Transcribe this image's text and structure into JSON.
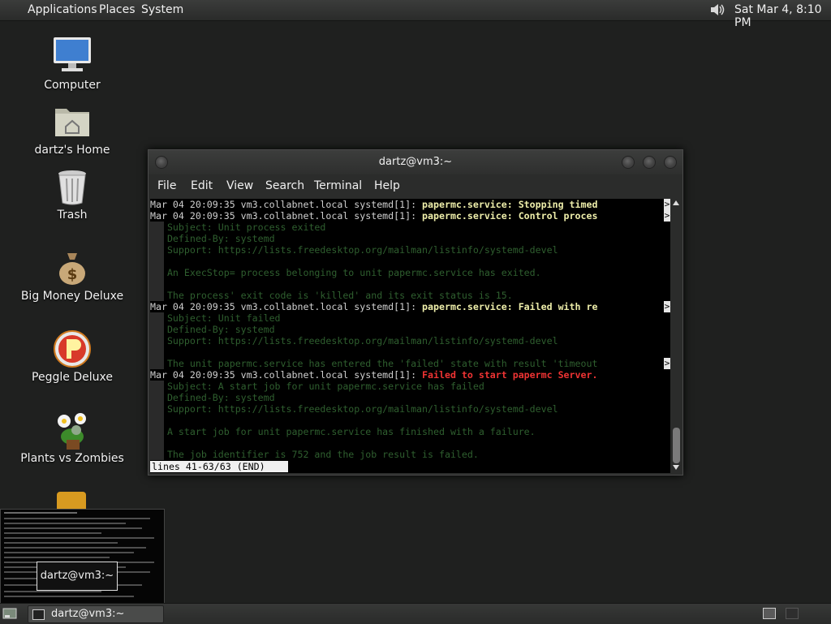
{
  "top_panel": {
    "menus": [
      "Applications",
      "Places",
      "System"
    ],
    "clock": "Sat Mar  4,  8:10 PM",
    "volume_icon": "speaker-icon"
  },
  "desktop_icons": [
    {
      "label": "Computer",
      "icon": "computer-icon"
    },
    {
      "label": "dartz's Home",
      "icon": "home-folder-icon"
    },
    {
      "label": "Trash",
      "icon": "trash-icon"
    },
    {
      "label": "Big Money Deluxe",
      "icon": "money-bag-icon"
    },
    {
      "label": "Peggle Deluxe",
      "icon": "peggle-icon"
    },
    {
      "label": "Plants vs Zombies",
      "icon": "plants-vs-zombies-icon"
    }
  ],
  "terminal": {
    "title": "dartz@vm3:~",
    "menu": [
      "File",
      "Edit",
      "View",
      "Search",
      "Terminal",
      "Help"
    ],
    "lines": [
      {
        "prefix": "Mar 04 20:09:35 vm3.collabnet.local systemd[1]: ",
        "msg": "papermc.service: Stopping timed",
        "style": "tw",
        "trunc": true
      },
      {
        "prefix": "Mar 04 20:09:35 vm3.collabnet.local systemd[1]: ",
        "msg": "papermc.service: Control proces",
        "style": "tw",
        "trunc": true
      },
      {
        "prefix": "",
        "msg": "   Subject: Unit process exited",
        "style": "tg",
        "trunc": false
      },
      {
        "prefix": "",
        "msg": "   Defined-By: systemd",
        "style": "tg",
        "trunc": false
      },
      {
        "prefix": "",
        "msg": "   Support: https://lists.freedesktop.org/mailman/listinfo/systemd-devel",
        "style": "tg",
        "trunc": false
      },
      {
        "prefix": "",
        "msg": "",
        "style": "tg",
        "trunc": false
      },
      {
        "prefix": "",
        "msg": "   An ExecStop= process belonging to unit papermc.service has exited.",
        "style": "tg",
        "trunc": false
      },
      {
        "prefix": "",
        "msg": "",
        "style": "tg",
        "trunc": false
      },
      {
        "prefix": "",
        "msg": "   The process' exit code is 'killed' and its exit status is 15.",
        "style": "tg",
        "trunc": false
      },
      {
        "prefix": "Mar 04 20:09:35 vm3.collabnet.local systemd[1]: ",
        "msg": "papermc.service: Failed with re",
        "style": "tw",
        "trunc": true
      },
      {
        "prefix": "",
        "msg": "   Subject: Unit failed",
        "style": "tg",
        "trunc": false
      },
      {
        "prefix": "",
        "msg": "   Defined-By: systemd",
        "style": "tg",
        "trunc": false
      },
      {
        "prefix": "",
        "msg": "   Support: https://lists.freedesktop.org/mailman/listinfo/systemd-devel",
        "style": "tg",
        "trunc": false
      },
      {
        "prefix": "",
        "msg": "",
        "style": "tg",
        "trunc": false
      },
      {
        "prefix": "",
        "msg": "   The unit papermc.service has entered the 'failed' state with result 'timeout",
        "style": "tg",
        "trunc": true
      },
      {
        "prefix": "Mar 04 20:09:35 vm3.collabnet.local systemd[1]: ",
        "msg": "Failed to start papermc Server.",
        "style": "tr",
        "trunc": false
      },
      {
        "prefix": "",
        "msg": "   Subject: A start job for unit papermc.service has failed",
        "style": "tg",
        "trunc": false
      },
      {
        "prefix": "",
        "msg": "   Defined-By: systemd",
        "style": "tg",
        "trunc": false
      },
      {
        "prefix": "",
        "msg": "   Support: https://lists.freedesktop.org/mailman/listinfo/systemd-devel",
        "style": "tg",
        "trunc": false
      },
      {
        "prefix": "",
        "msg": "",
        "style": "tg",
        "trunc": false
      },
      {
        "prefix": "",
        "msg": "   A start job for unit papermc.service has finished with a failure.",
        "style": "tg",
        "trunc": false
      },
      {
        "prefix": "",
        "msg": "",
        "style": "tg",
        "trunc": false
      },
      {
        "prefix": "",
        "msg": "   The job identifier is 752 and the job result is failed.",
        "style": "tg",
        "trunc": false
      }
    ],
    "truncation_marker": ">",
    "pager_status": "lines 41-63/63 (END)"
  },
  "preview": {
    "tooltip": "dartz@vm3:~"
  },
  "taskbar": {
    "task_label": "dartz@vm3:~"
  }
}
